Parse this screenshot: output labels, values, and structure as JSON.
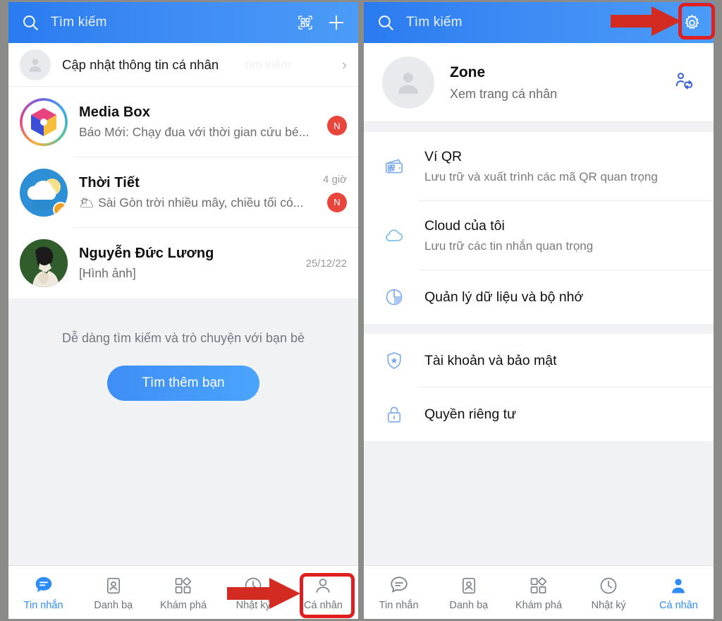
{
  "left_panel": {
    "header": {
      "title": "Tìm kiếm",
      "search_icon": "search-icon",
      "qr_icon": "qr-scan-icon",
      "add_icon": "plus-icon"
    },
    "update_profile": {
      "label": "Cập nhật thông tin cá nhân",
      "ghost_hint": "tìm kiếm",
      "chevron": "›"
    },
    "chats": [
      {
        "name": "Media Box",
        "preview": "Báo Mới: Chạy đua với thời gian cứu bé...",
        "time": "",
        "badge": "N",
        "avatar": "media-box-logo"
      },
      {
        "name": "Thời Tiết",
        "preview": "🌥 Sài Gòn trời nhiều mây, chiều tối có...",
        "time": "4 giờ",
        "badge": "N",
        "avatar": "weather-logo"
      },
      {
        "name": "Nguyễn Đức Lương",
        "preview": "[Hình ảnh]",
        "time": "25/12/22",
        "badge": "",
        "avatar": "person-photo"
      }
    ],
    "empty_state": {
      "text": "Dễ dàng tìm kiếm và trò chuyện với bạn bè",
      "button_label": "Tìm thêm bạn"
    },
    "tabs": [
      {
        "label": "Tin nhắn",
        "icon": "chat-bubble-icon",
        "active": true
      },
      {
        "label": "Danh bạ",
        "icon": "contacts-icon",
        "active": false
      },
      {
        "label": "Khám phá",
        "icon": "discover-icon",
        "active": false
      },
      {
        "label": "Nhật ký",
        "icon": "clock-icon",
        "active": false
      },
      {
        "label": "Cá nhân",
        "icon": "person-icon",
        "active": false
      }
    ]
  },
  "right_panel": {
    "header": {
      "title": "Tìm kiếm",
      "search_icon": "search-icon",
      "gear_icon": "gear-icon"
    },
    "profile": {
      "name": "Zone",
      "subtitle": "Xem trang cá nhân",
      "switch_icon": "switch-account-icon"
    },
    "settings_groups": [
      {
        "items": [
          {
            "title": "Ví QR",
            "subtitle": "Lưu trữ và xuất trình các mã QR quan trọng",
            "icon": "qr-wallet-icon"
          },
          {
            "title": "Cloud của tôi",
            "subtitle": "Lưu trữ các tin nhắn quan trọng",
            "icon": "cloud-icon"
          },
          {
            "title": "Quản lý dữ liệu và bộ nhớ",
            "subtitle": "",
            "icon": "pie-chart-icon"
          }
        ]
      },
      {
        "items": [
          {
            "title": "Tài khoản và bảo mật",
            "subtitle": "",
            "icon": "shield-icon"
          },
          {
            "title": "Quyền riêng tư",
            "subtitle": "",
            "icon": "lock-icon"
          }
        ]
      }
    ],
    "tabs": [
      {
        "label": "Tin nhắn",
        "icon": "chat-bubble-icon",
        "active": false
      },
      {
        "label": "Danh bạ",
        "icon": "contacts-icon",
        "active": false
      },
      {
        "label": "Khám phá",
        "icon": "discover-icon",
        "active": false
      },
      {
        "label": "Nhật ký",
        "icon": "clock-icon",
        "active": false
      },
      {
        "label": "Cá nhân",
        "icon": "person-icon",
        "active": true
      }
    ]
  },
  "annotations": {
    "color": "#e02020",
    "gear_highlight": "gear-button-highlight",
    "tab_highlight": "ca-nhan-tab-highlight",
    "arrow_top": "arrow-pointing-to-gear",
    "arrow_bottom": "arrow-pointing-to-ca-nhan-tab"
  },
  "colors": {
    "header_blue": "#3d8bf4",
    "accent_blue": "#2d8cf5",
    "badge_red": "#e8453c",
    "annotation_red": "#e02020",
    "page_bg": "#f1f2f4"
  }
}
